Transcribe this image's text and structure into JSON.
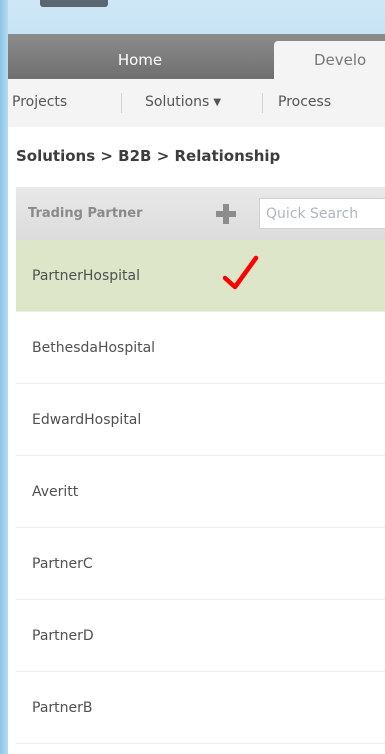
{
  "header_tabs": [
    {
      "label": "Home",
      "active": false
    },
    {
      "label": "Develo",
      "active": true
    }
  ],
  "subnav": {
    "items": [
      {
        "label": "Projects"
      },
      {
        "label": "Solutions",
        "has_dropdown": true
      },
      {
        "label": "Process"
      }
    ],
    "dropdown_icon": "caret-down-icon"
  },
  "breadcrumb": "Solutions > B2B > Relationship",
  "trading_partner_panel": {
    "header_label": "Trading Partner",
    "add_icon": "plus-icon",
    "search_placeholder": "Quick Search",
    "selected_index": 0,
    "selection_marker": "red-checkmark-icon",
    "partners": [
      "PartnerHospital",
      "BethesdaHospital",
      "EdwardHospital",
      "Averitt",
      "PartnerC",
      "PartnerD",
      "PartnerB"
    ]
  },
  "colors": {
    "tab_bar": "#7a7a7a",
    "selected_row": "#dde6c8",
    "checkmark": "#ff0000",
    "page_background": "#a9d6ef"
  }
}
